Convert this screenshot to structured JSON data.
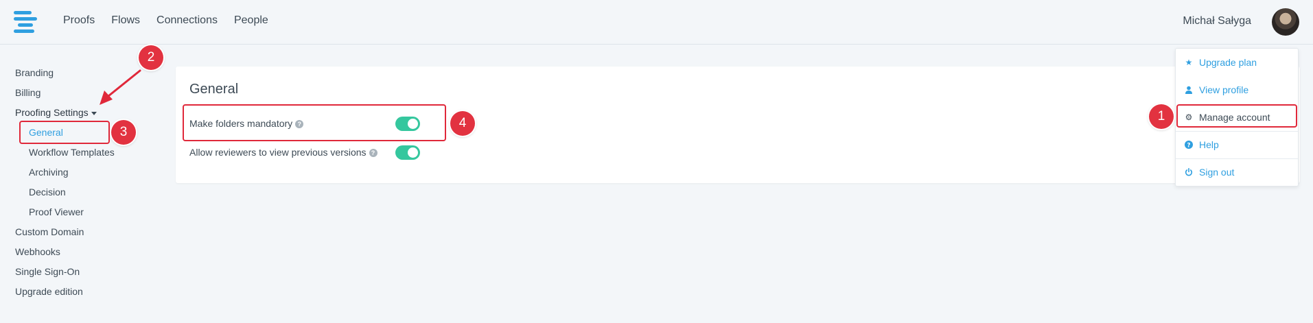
{
  "header": {
    "nav": [
      "Proofs",
      "Flows",
      "Connections",
      "People"
    ],
    "username": "Michał Sałyga"
  },
  "sidebar": {
    "items": [
      {
        "label": "Branding"
      },
      {
        "label": "Billing"
      },
      {
        "label": "Proofing Settings"
      },
      {
        "label": "General"
      },
      {
        "label": "Workflow Templates"
      },
      {
        "label": "Archiving"
      },
      {
        "label": "Decision"
      },
      {
        "label": "Proof Viewer"
      },
      {
        "label": "Custom Domain"
      },
      {
        "label": "Webhooks"
      },
      {
        "label": "Single Sign-On"
      },
      {
        "label": "Upgrade edition"
      }
    ]
  },
  "main": {
    "title": "General",
    "settings": [
      {
        "label": "Make folders mandatory",
        "enabled": true
      },
      {
        "label": "Allow reviewers to view previous versions",
        "enabled": true
      }
    ]
  },
  "dropdown": {
    "items": [
      {
        "label": "Upgrade plan",
        "icon": "star-icon"
      },
      {
        "label": "View profile",
        "icon": "user-icon"
      },
      {
        "label": "Manage account",
        "icon": "gear-icon"
      },
      {
        "label": "Help",
        "icon": "question-icon"
      },
      {
        "label": "Sign out",
        "icon": "power-icon"
      }
    ]
  },
  "annotations": [
    "1",
    "2",
    "3",
    "4"
  ],
  "colors": {
    "accent": "#2f9fe0",
    "toggle_on": "#35c79e",
    "annotation": "#e23240",
    "background": "#f3f6f9"
  }
}
